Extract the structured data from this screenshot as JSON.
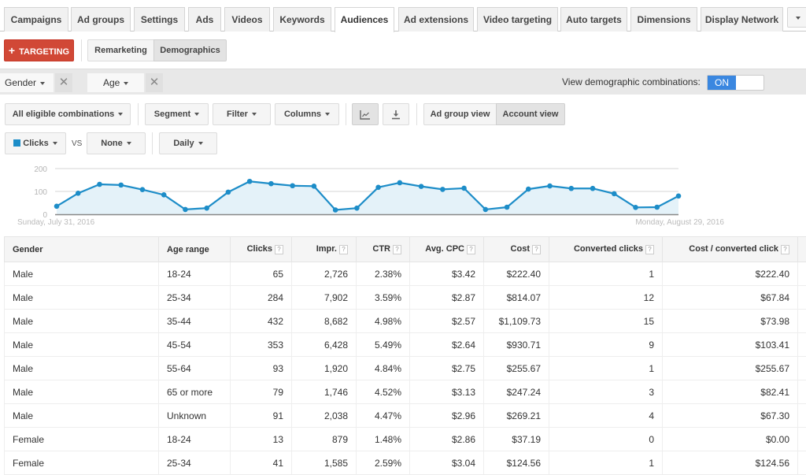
{
  "tabs": [
    {
      "label": "Campaigns",
      "active": false
    },
    {
      "label": "Ad groups",
      "active": false
    },
    {
      "label": "Settings",
      "active": false
    },
    {
      "label": "Ads",
      "active": false
    },
    {
      "label": "Videos",
      "active": false
    },
    {
      "label": "Keywords",
      "active": false
    },
    {
      "label": "Audiences",
      "active": true
    },
    {
      "label": "Ad extensions",
      "active": false
    },
    {
      "label": "Video targeting",
      "active": false
    },
    {
      "label": "Auto targets",
      "active": false
    },
    {
      "label": "Dimensions",
      "active": false
    },
    {
      "label": "Display Network",
      "active": false
    }
  ],
  "targeting_button": "TARGETING",
  "subtabs": {
    "remarketing": "Remarketing",
    "demographics": "Demographics"
  },
  "filters": {
    "gender": "Gender",
    "age": "Age"
  },
  "view_combinations": {
    "label": "View demographic combinations:",
    "state": "ON"
  },
  "toolbar": {
    "combinations": "All eligible combinations",
    "segment": "Segment",
    "filter": "Filter",
    "columns": "Columns",
    "ad_group_view": "Ad group view",
    "account_view": "Account view"
  },
  "metrics": {
    "primary": "Clicks",
    "vs": "VS",
    "secondary": "None",
    "period": "Daily",
    "series_color": "#1d8dc8"
  },
  "chart_data": {
    "type": "area",
    "title": "",
    "series": [
      {
        "name": "Clicks",
        "values": [
          35,
          92,
          131,
          128,
          108,
          85,
          21,
          27,
          97,
          144,
          134,
          125,
          123,
          19,
          27,
          118,
          138,
          122,
          109,
          114,
          21,
          31,
          110,
          124,
          113,
          113,
          90,
          30,
          31,
          80
        ]
      }
    ],
    "x_start_label": "Sunday, July 31, 2016",
    "x_end_label": "Monday, August 29, 2016",
    "yticks": [
      0,
      100,
      200
    ],
    "ylim": [
      0,
      200
    ],
    "grid": true
  },
  "table": {
    "columns": [
      {
        "label": "Gender",
        "help": false
      },
      {
        "label": "Age range",
        "help": false
      },
      {
        "label": "Clicks",
        "help": true
      },
      {
        "label": "Impr.",
        "help": true
      },
      {
        "label": "CTR",
        "help": true
      },
      {
        "label": "Avg. CPC",
        "help": true
      },
      {
        "label": "Cost",
        "help": true
      },
      {
        "label": "Converted clicks",
        "help": true
      },
      {
        "label": "Cost / converted click",
        "help": true
      }
    ],
    "help_glyph": "?",
    "rows": [
      [
        "Male",
        "18-24",
        "65",
        "2,726",
        "2.38%",
        "$3.42",
        "$222.40",
        "1",
        "$222.40"
      ],
      [
        "Male",
        "25-34",
        "284",
        "7,902",
        "3.59%",
        "$2.87",
        "$814.07",
        "12",
        "$67.84"
      ],
      [
        "Male",
        "35-44",
        "432",
        "8,682",
        "4.98%",
        "$2.57",
        "$1,109.73",
        "15",
        "$73.98"
      ],
      [
        "Male",
        "45-54",
        "353",
        "6,428",
        "5.49%",
        "$2.64",
        "$930.71",
        "9",
        "$103.41"
      ],
      [
        "Male",
        "55-64",
        "93",
        "1,920",
        "4.84%",
        "$2.75",
        "$255.67",
        "1",
        "$255.67"
      ],
      [
        "Male",
        "65 or more",
        "79",
        "1,746",
        "4.52%",
        "$3.13",
        "$247.24",
        "3",
        "$82.41"
      ],
      [
        "Male",
        "Unknown",
        "91",
        "2,038",
        "4.47%",
        "$2.96",
        "$269.21",
        "4",
        "$67.30"
      ],
      [
        "Female",
        "18-24",
        "13",
        "879",
        "1.48%",
        "$2.86",
        "$37.19",
        "0",
        "$0.00"
      ],
      [
        "Female",
        "25-34",
        "41",
        "1,585",
        "2.59%",
        "$3.04",
        "$124.56",
        "1",
        "$124.56"
      ]
    ]
  }
}
